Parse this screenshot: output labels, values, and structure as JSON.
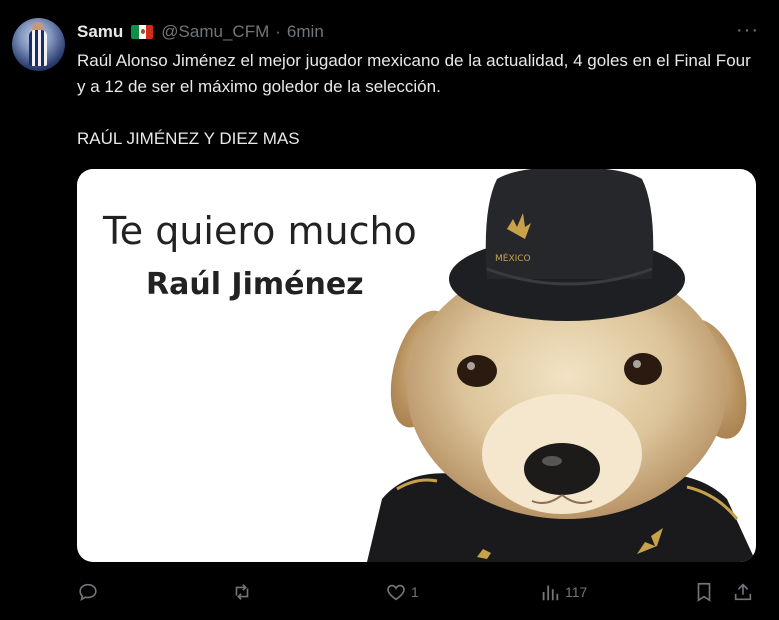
{
  "author": {
    "name": "Samu",
    "flag": "mexico-flag-icon",
    "handle": "@Samu_CFM",
    "separator": "·",
    "time": "6min"
  },
  "more_icon": "more-options-icon",
  "tweet": {
    "line1": "Raúl Alonso Jiménez el mejor jugador mexicano de la actualidad, 4 goles en el Final Four y a 12 de ser el máximo goledor de la selección.",
    "line2": "RAÚL JIMÉNEZ Y DIEZ MAS"
  },
  "media": {
    "text1": "Te quiero mucho",
    "text2": "Raúl Jiménez",
    "hat_text": "MÉXICO"
  },
  "actions": {
    "reply": {
      "icon": "reply-icon",
      "count": ""
    },
    "repost": {
      "icon": "repost-icon",
      "count": ""
    },
    "like": {
      "icon": "heart-icon",
      "count": "1"
    },
    "views": {
      "icon": "views-icon",
      "count": "117"
    },
    "bookmark": {
      "icon": "bookmark-icon"
    },
    "share": {
      "icon": "share-icon"
    }
  },
  "colors": {
    "background": "#000000",
    "text": "#e7e9ea",
    "muted": "#71767b"
  }
}
